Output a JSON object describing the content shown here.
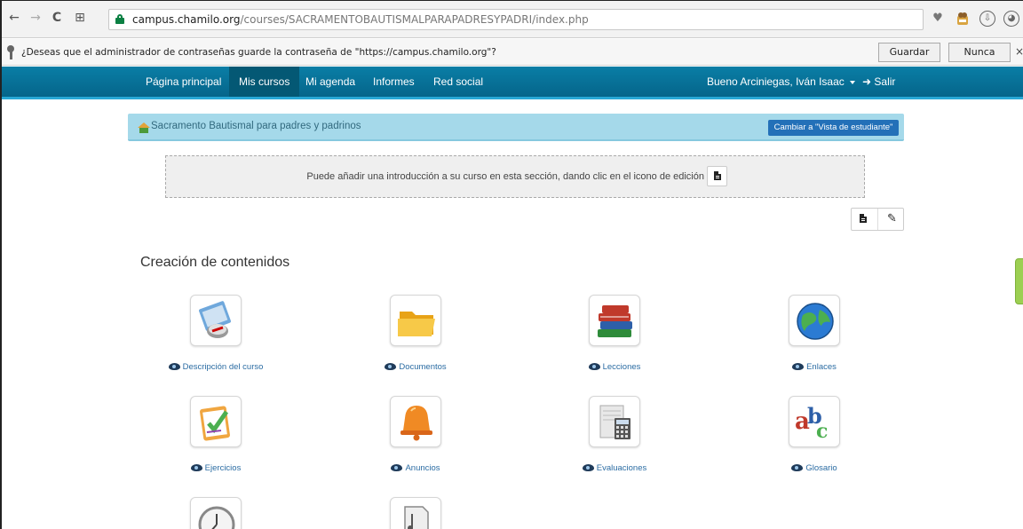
{
  "browser": {
    "url_host": "campus.chamilo.org",
    "url_path": "/courses/SACRAMENTOBAUTISMALPARAPADRESYPADRI/index.php",
    "password_prompt": {
      "message": "¿Deseas que el administrador de contraseñas guarde la contraseña de \"https://campus.chamilo.org\"?",
      "save_label": "Guardar",
      "never_label": "Nunca",
      "close_glyph": "×"
    },
    "nav_glyphs": {
      "back": "←",
      "forward": "→",
      "reload": "C",
      "apps": "⊞"
    },
    "toolbar_glyphs": {
      "heart": "♥",
      "download": "⇩",
      "profile": "◕"
    }
  },
  "navbar": {
    "items": [
      "Página principal",
      "Mis cursos",
      "Mi agenda",
      "Informes",
      "Red social"
    ],
    "active_item": "Mis cursos",
    "user_label": "Bueno Arciniegas, Iván Isaac",
    "logout_label": "➜ Salir"
  },
  "course": {
    "breadcrumb_title": "Sacramento Bautismal para padres y padrinos",
    "student_view_button": "Cambiar a \"Vista de estudiante\"",
    "intro_text": "Puede añadir una introducción a su curso en esta sección, dando clic en el icono de edición",
    "wrench_glyph": "✎"
  },
  "section": {
    "title": "Creación de contenidos",
    "tools": [
      {
        "label": "Descripción del curso",
        "icon": "course-description-icon"
      },
      {
        "label": "Documentos",
        "icon": "folder-icon"
      },
      {
        "label": "Lecciones",
        "icon": "books-icon"
      },
      {
        "label": "Enlaces",
        "icon": "globe-icon"
      },
      {
        "label": "Ejercicios",
        "icon": "checklist-icon"
      },
      {
        "label": "Anuncios",
        "icon": "bell-icon"
      },
      {
        "label": "Evaluaciones",
        "icon": "calculator-icon"
      },
      {
        "label": "Glosario",
        "icon": "abc-icon"
      },
      {
        "label": "",
        "icon": "clock-icon"
      },
      {
        "label": "",
        "icon": "music-book-icon"
      }
    ]
  },
  "colors": {
    "navbar": "#05658a",
    "active_nav": "#045874",
    "breadcrumb_bg": "#a5d9ea",
    "student_button": "#2370b8",
    "tool_label": "#2b6ca3"
  }
}
